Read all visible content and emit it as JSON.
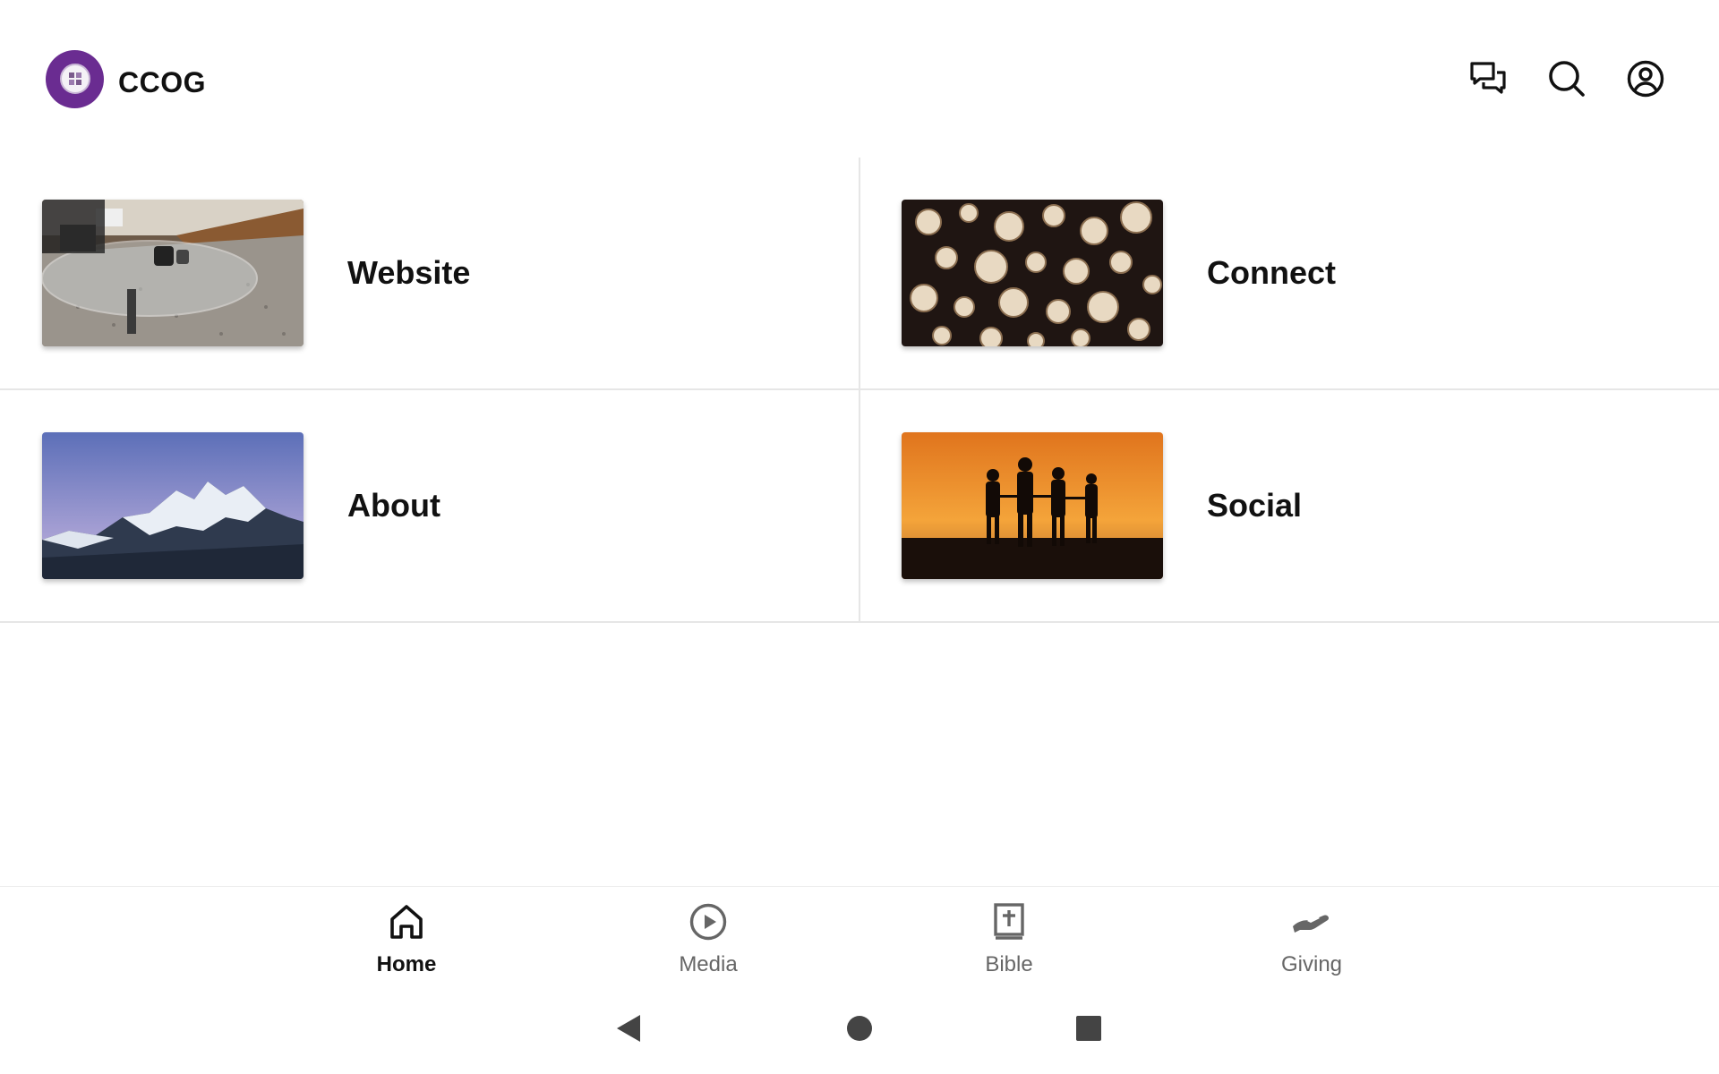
{
  "app": {
    "name": "CCOG"
  },
  "header": {
    "icons": [
      "messages-icon",
      "search-icon",
      "account-icon"
    ]
  },
  "tiles": [
    {
      "label": "Website",
      "image": "living-room-table-photo"
    },
    {
      "label": "Connect",
      "image": "stacked-logs-photo"
    },
    {
      "label": "About",
      "image": "snowy-mountains-photo"
    },
    {
      "label": "Social",
      "image": "sunset-silhouettes-photo"
    }
  ],
  "bottom_nav": {
    "active": "Home",
    "items": [
      {
        "label": "Home",
        "icon": "home-icon"
      },
      {
        "label": "Media",
        "icon": "play-circle-icon"
      },
      {
        "label": "Bible",
        "icon": "bible-icon"
      },
      {
        "label": "Giving",
        "icon": "giving-hand-icon"
      }
    ]
  },
  "system_nav": [
    "back-icon",
    "home-circle-icon",
    "recents-square-icon"
  ],
  "colors": {
    "brand": "#6a2c91",
    "divider": "#e6e6e6",
    "inactive": "#666666"
  }
}
